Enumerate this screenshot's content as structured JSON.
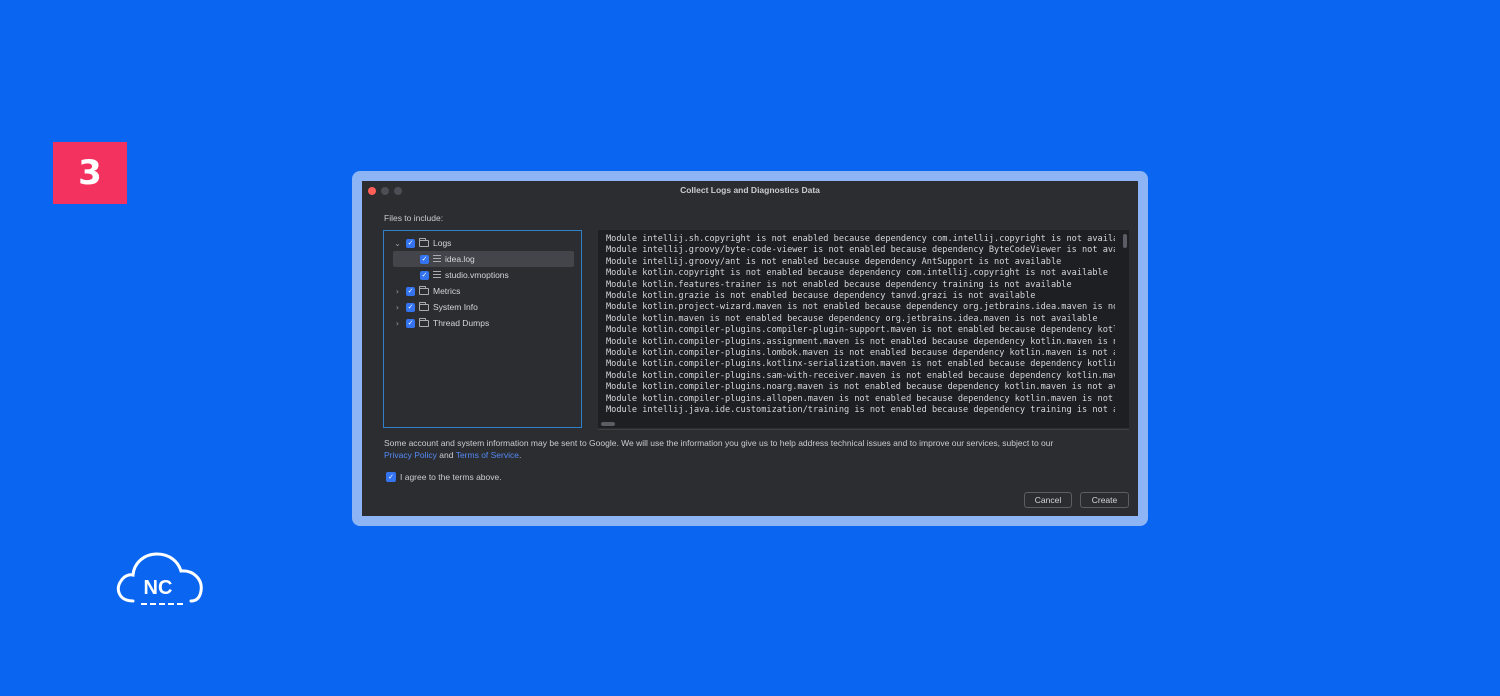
{
  "step_badge": "3",
  "logo_text": "NC",
  "dialog": {
    "title": "Collect Logs and Diagnostics Data",
    "files_label": "Files to include:",
    "tree": [
      {
        "label": "Logs",
        "expanded": true,
        "checked": true,
        "type": "folder"
      },
      {
        "label": "idea.log",
        "checked": true,
        "type": "file",
        "selected": true
      },
      {
        "label": "studio.vmoptions",
        "checked": true,
        "type": "file"
      },
      {
        "label": "Metrics",
        "expanded": false,
        "checked": true,
        "type": "folder"
      },
      {
        "label": "System Info",
        "expanded": false,
        "checked": true,
        "type": "folder"
      },
      {
        "label": "Thread Dumps",
        "expanded": false,
        "checked": true,
        "type": "folder"
      }
    ],
    "log_lines": [
      "Module intellij.sh.copyright is not enabled because dependency com.intellij.copyright is not availa",
      "Module intellij.groovy/byte-code-viewer is not enabled because dependency ByteCodeViewer is not ava",
      "Module intellij.groovy/ant is not enabled because dependency AntSupport is not available",
      "Module kotlin.copyright is not enabled because dependency com.intellij.copyright is not available",
      "Module kotlin.features-trainer is not enabled because dependency training is not available",
      "Module kotlin.grazie is not enabled because dependency tanvd.grazi is not available",
      "Module kotlin.project-wizard.maven is not enabled because dependency org.jetbrains.idea.maven is no",
      "Module kotlin.maven is not enabled because dependency org.jetbrains.idea.maven is not available",
      "Module kotlin.compiler-plugins.compiler-plugin-support.maven is not enabled because dependency kotl",
      "Module kotlin.compiler-plugins.assignment.maven is not enabled because dependency kotlin.maven is n",
      "Module kotlin.compiler-plugins.lombok.maven is not enabled because dependency kotlin.maven is not a",
      "Module kotlin.compiler-plugins.kotlinx-serialization.maven is not enabled because dependency kotlin",
      "Module kotlin.compiler-plugins.sam-with-receiver.maven is not enabled because dependency kotlin.mav",
      "Module kotlin.compiler-plugins.noarg.maven is not enabled because dependency kotlin.maven is not av",
      "Module kotlin.compiler-plugins.allopen.maven is not enabled because dependency kotlin.maven is not",
      "Module intellij.java.ide.customization/training is not enabled because dependency training is not a"
    ],
    "notice_text": "Some account and system information may be sent to Google. We will use the information you give us to help address technical issues and to improve our services, subject to our",
    "privacy_link": "Privacy Policy",
    "notice_and": "and",
    "terms_link": "Terms of Service",
    "notice_end": ".",
    "agree_label": "I agree to the terms above.",
    "agree_checked": true,
    "cancel_label": "Cancel",
    "create_label": "Create"
  }
}
